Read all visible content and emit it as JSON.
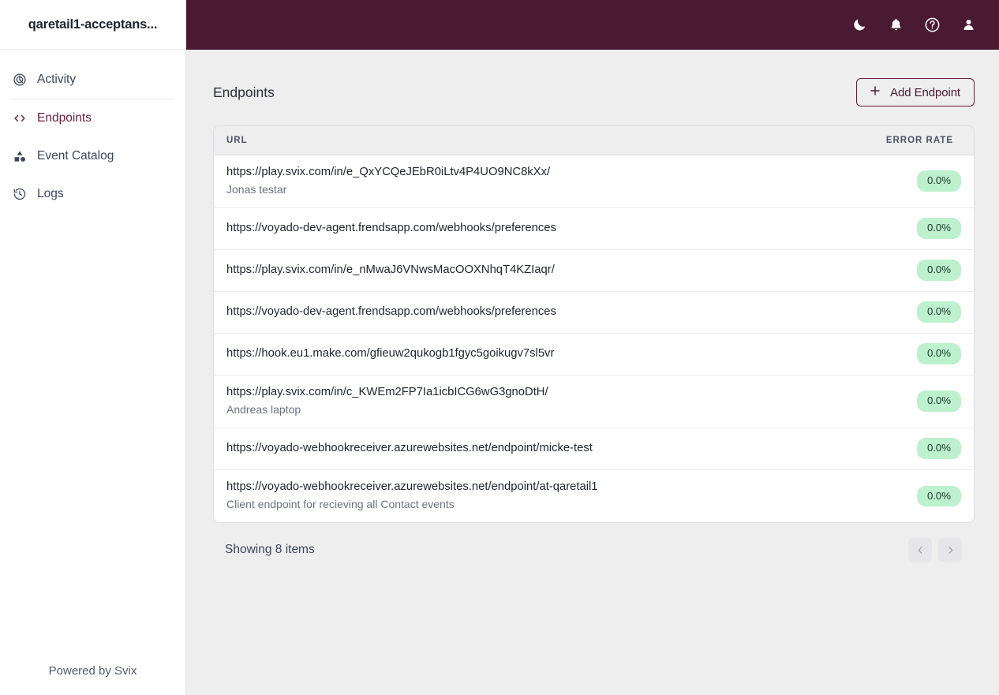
{
  "sidebar": {
    "title": "qaretail1-acceptans...",
    "items": [
      {
        "label": "Activity",
        "icon": "activity-icon",
        "active": false
      },
      {
        "label": "Endpoints",
        "icon": "code-brackets-icon",
        "active": true
      },
      {
        "label": "Event Catalog",
        "icon": "shapes-icon",
        "active": false
      },
      {
        "label": "Logs",
        "icon": "history-clock-icon",
        "active": false
      }
    ],
    "footer": "Powered by Svix"
  },
  "topbar": {
    "background": "#4a1a33",
    "icons": [
      {
        "name": "dark-mode-moon-icon"
      },
      {
        "name": "notifications-bell-icon"
      },
      {
        "name": "help-question-icon"
      },
      {
        "name": "user-account-icon"
      }
    ]
  },
  "page": {
    "title": "Endpoints",
    "add_button_label": "Add Endpoint",
    "accent_color": "#6b1c3c"
  },
  "table": {
    "columns": [
      "URL",
      "ERROR RATE"
    ],
    "rows": [
      {
        "url": "https://play.svix.com/in/e_QxYCQeJEbR0iLtv4P4UO9NC8kXx/",
        "description": "Jonas testar",
        "error_rate": "0.0%"
      },
      {
        "url": "https://voyado-dev-agent.frendsapp.com/webhooks/preferences",
        "description": "",
        "error_rate": "0.0%"
      },
      {
        "url": "https://play.svix.com/in/e_nMwaJ6VNwsMacOOXNhqT4KZIaqr/",
        "description": "",
        "error_rate": "0.0%"
      },
      {
        "url": "https://voyado-dev-agent.frendsapp.com/webhooks/preferences",
        "description": "",
        "error_rate": "0.0%"
      },
      {
        "url": "https://hook.eu1.make.com/gfieuw2qukogb1fgyc5goikugv7sl5vr",
        "description": "",
        "error_rate": "0.0%"
      },
      {
        "url": "https://play.svix.com/in/c_KWEm2FP7Ia1icbICG6wG3gnoDtH/",
        "description": "Andreas laptop",
        "error_rate": "0.0%"
      },
      {
        "url": "https://voyado-webhookreceiver.azurewebsites.net/endpoint/micke-test",
        "description": "",
        "error_rate": "0.0%"
      },
      {
        "url": "https://voyado-webhookreceiver.azurewebsites.net/endpoint/at-qaretail1",
        "description": "Client endpoint for recieving all Contact events",
        "error_rate": "0.0%"
      }
    ],
    "badge_background": "#bdf0cd"
  },
  "pagination": {
    "showing_label": "Showing 8 items",
    "prev_icon": "chevron-left-icon",
    "next_icon": "chevron-right-icon"
  }
}
